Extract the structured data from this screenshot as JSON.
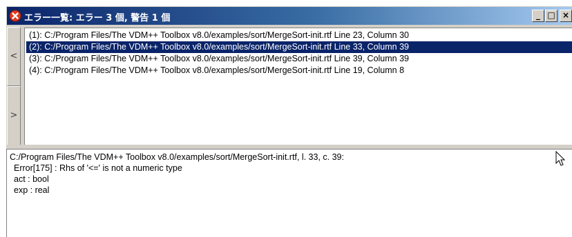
{
  "window": {
    "title": "エラー一覧: エラー 3 個, 警告 1 個",
    "title_icon": "error-circle-icon",
    "controls": {
      "minimize": "_",
      "maximize": "□",
      "close": "×"
    }
  },
  "nav": {
    "prev_label": "<",
    "next_label": ">"
  },
  "errors": [
    {
      "label": "(1): C:/Program Files/The VDM++ Toolbox v8.0/examples/sort/MergeSort-init.rtf Line 23, Column 30",
      "selected": false
    },
    {
      "label": "(2): C:/Program Files/The VDM++ Toolbox v8.0/examples/sort/MergeSort-init.rtf Line 33, Column 39",
      "selected": true
    },
    {
      "label": "(3): C:/Program Files/The VDM++ Toolbox v8.0/examples/sort/MergeSort-init.rtf Line 39, Column 39",
      "selected": false
    },
    {
      "label": "(4): C:/Program Files/The VDM++ Toolbox v8.0/examples/sort/MergeSort-init.rtf Line 19, Column 8",
      "selected": false
    }
  ],
  "detail": {
    "location": "C:/Program Files/The VDM++ Toolbox v8.0/examples/sort/MergeSort-init.rtf, l. 33, c. 39:",
    "message": "Error[175] : Rhs of '<=' is not a numeric type",
    "act": "act : bool",
    "exp": "exp : real"
  },
  "colors": {
    "title_start": "#0a246a",
    "title_end": "#a6caf0",
    "selection": "#0a246a",
    "chrome": "#d4d0c8",
    "close_icon": "#e03a1e"
  }
}
